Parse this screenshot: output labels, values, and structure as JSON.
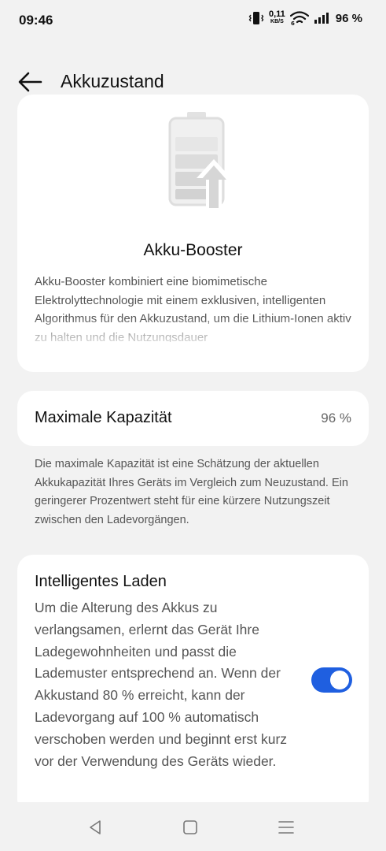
{
  "status_bar": {
    "time": "09:46",
    "net_speed_value": "0,11",
    "net_speed_unit": "KB/S",
    "battery_percent": "96 %",
    "icons": [
      "vibrate-icon",
      "wifi-6-icon",
      "signal-icon"
    ]
  },
  "header": {
    "title": "Akkuzustand",
    "back_icon": "arrow-left-icon"
  },
  "booster": {
    "illustration": "battery-boost-icon",
    "title": "Akku-Booster",
    "description": "Akku-Booster kombiniert eine biomimetische Elektrolyttechnologie mit einem exklusiven, intelligenten Algorithmus für den Akkuzustand, um die Lithium-Ionen aktiv zu halten und die Nutzungsdauer"
  },
  "capacity": {
    "label": "Maximale Kapazität",
    "value": "96 %",
    "note": "Die maximale Kapazität ist eine Schätzung der aktuellen Akkukapazität Ihres Geräts im Vergleich zum Neuzustand. Ein geringerer Prozentwert steht für eine kürzere Nutzungszeit zwischen den Ladevorgängen."
  },
  "smart_charging": {
    "title": "Intelligentes Laden",
    "description": "Um die Alterung des Akkus zu verlangsamen, erlernt das Gerät Ihre Ladegewohnheiten und passt die Lademuster entsprechend an. Wenn der Akkustand 80 % erreicht, kann der Ladevorgang auf 100 % automatisch verschoben werden und beginnt erst kurz vor der Verwendung des Geräts wieder.",
    "enabled": true,
    "toggle_color": "#1f5fe0"
  },
  "nav_bar": {
    "icons": [
      "back-triangle-icon",
      "home-square-icon",
      "recents-menu-icon"
    ]
  }
}
